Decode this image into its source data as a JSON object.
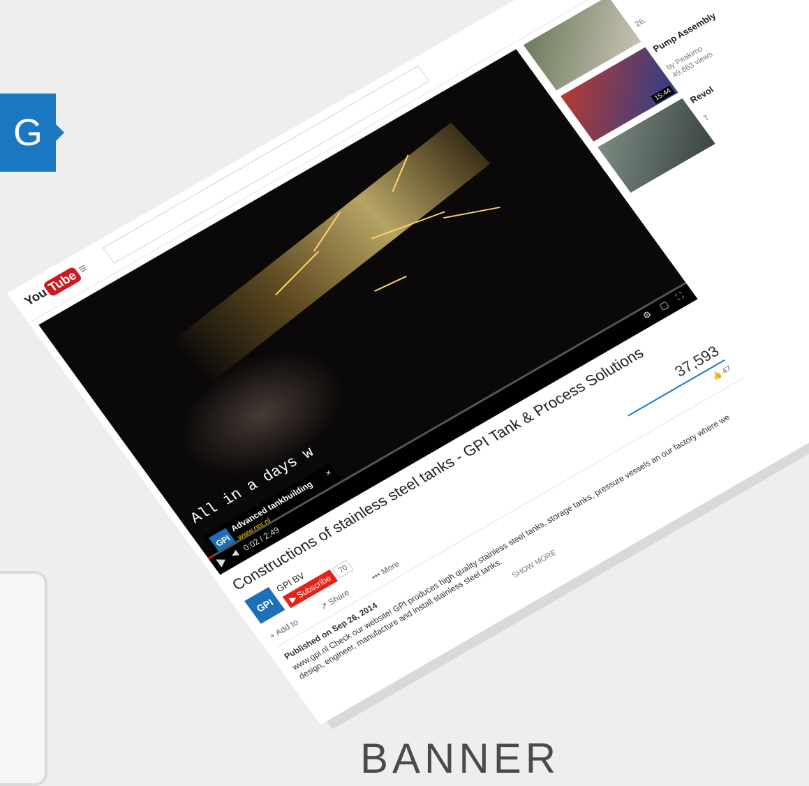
{
  "decor": {
    "tag_letter": "G",
    "bottom_word": "BANNER"
  },
  "colors": {
    "youtube_red": "#cc181e",
    "subscribe_red": "#e62117",
    "brand_blue": "#1a78c2",
    "views_bar_blue": "#167ac6"
  },
  "youtube": {
    "logo_you": "You",
    "logo_tube": "Tube",
    "menu_icon": "≡",
    "search_placeholder": ""
  },
  "player": {
    "subtitle": "All in a days w",
    "ad": {
      "logo": "GPI",
      "title": "Advanced tankbuilding",
      "url": "www.gpi.nl",
      "close": "×"
    },
    "time_current": "0:02",
    "time_total": "2:49",
    "progress": 0.012,
    "right_icons": "⚙ ▢ ⛶"
  },
  "video": {
    "title": "Constructions of stainless steel tanks - GPI Tank & Process Solutions",
    "channel": {
      "logo": "GPI",
      "name": "GPI BV",
      "subscribe_label": "Subscribe",
      "subscriber_count": "70"
    },
    "views": "37,593",
    "likes": "47",
    "actions": {
      "add_to": "Add to",
      "share": "Share",
      "more": "More"
    },
    "published": "Published on Sep 26, 2014",
    "description": "www.gpi.nl Check our website! GPI produces high quality stainless steel tanks, storage tanks, pressure vessels an our factory where we design, engineer, manufacture and install stainless steel tanks.",
    "show_more": "SHOW MORE"
  },
  "related": [
    {
      "title": "",
      "by": "",
      "views": "26,",
      "duration": ""
    },
    {
      "title": "Pump Assembly",
      "by": "by Peakimo",
      "views": "49,663 views",
      "duration": "15:44"
    },
    {
      "title": "Revol",
      "by": "T",
      "views": "",
      "duration": ""
    }
  ]
}
